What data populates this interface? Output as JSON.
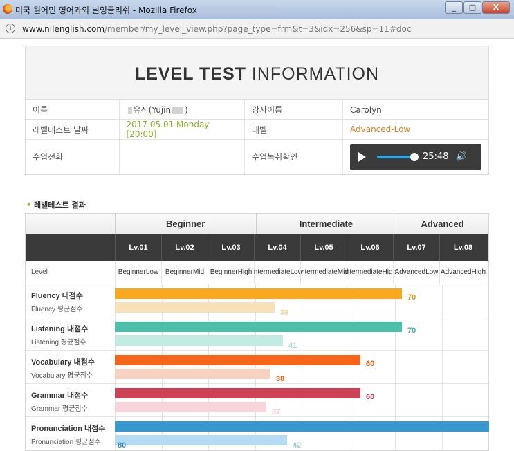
{
  "window": {
    "title": "미국 원어민 영어과외 닐잉글리쉬 - Mozilla Firefox",
    "min_label": "_",
    "max_label": "□",
    "close_label": "X"
  },
  "urlbar": {
    "domain": "www.nilenglish.com",
    "path": "/member/my_level_view.php?page_type=frm&t=3&idx=256&sp=11#doc"
  },
  "level_test": {
    "title_bold": "LEVEL TEST",
    "title_light": " INFORMATION",
    "rows": {
      "name_label": "이름",
      "name_value_pre": "유진(Yujin",
      "name_value_post": ")",
      "teacher_label": "강사이름",
      "teacher_value": "Carolyn",
      "date_label": "레벨테스트 날짜",
      "date_value": "2017.05.01   Monday [20:00]",
      "level_label": "레벨",
      "level_value": "Advanced-Low",
      "phone_label": "수업전화",
      "recording_label": "수업녹취확인"
    },
    "player": {
      "time": "25:48",
      "progress": 1.0
    }
  },
  "results": {
    "section_title": "레벨테스트 결과",
    "groups": [
      "Beginner",
      "Intermediate",
      "Advanced"
    ],
    "levels": [
      "Lv.01",
      "Lv.02",
      "Lv.03",
      "Lv.04",
      "Lv.05",
      "Lv.06",
      "Lv.07",
      "Lv.08"
    ],
    "level_header": "Level",
    "level_names": [
      [
        "Beginner",
        "Low"
      ],
      [
        "Beginner",
        "Mid"
      ],
      [
        "Beginner",
        "High"
      ],
      [
        "Intermediate",
        "Low"
      ],
      [
        "Intermediate",
        "Mid"
      ],
      [
        "Intermediate",
        "High"
      ],
      [
        "Advanced",
        "Low"
      ],
      [
        "Advanced",
        "High"
      ]
    ],
    "skills": [
      {
        "mine_label": "Fluency 내점수",
        "avg_label": "Fluency 평균점수",
        "mine": 70,
        "avg": 39,
        "mine_color": "#f9a91d",
        "avg_color": "#f8e0b9",
        "mine_score_color": "#e29a13",
        "avg_score_color": "#f0d49c"
      },
      {
        "mine_label": "Listening 내점수",
        "avg_label": "Listening 평균점수",
        "mine": 70,
        "avg": 41,
        "mine_color": "#4dbfa9",
        "avg_color": "#c1ebe3",
        "mine_score_color": "#3fb0a1",
        "avg_score_color": "#a8dcd3"
      },
      {
        "mine_label": "Vocabulary 내점수",
        "avg_label": "Vocabulary 평균점수",
        "mine": 60,
        "avg": 38,
        "mine_color": "#f7651a",
        "avg_color": "#f6d2c3",
        "mine_score_color": "#e0601a",
        "avg_score_color": "#e0601a"
      },
      {
        "mine_label": "Grammar 내점수",
        "avg_label": "Grammar 평균점수",
        "mine": 60,
        "avg": 37,
        "mine_color": "#cd4256",
        "avg_color": "#f6d5db",
        "mine_score_color": "#c0394d",
        "avg_score_color": "#f2c3cb"
      },
      {
        "mine_label": "Pronunciation 내점수",
        "avg_label": "Pronunciation 평균점수",
        "mine": 80,
        "avg": 42,
        "mine_color": "#3798cf",
        "avg_color": "#b5dcf2",
        "mine_score_color": "#2e86c1",
        "avg_score_color": "#9ccbe8"
      }
    ]
  }
}
